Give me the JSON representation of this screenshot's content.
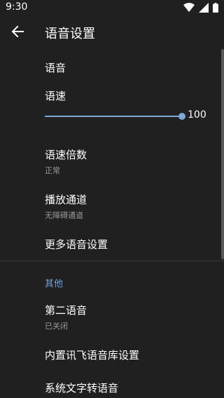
{
  "status_bar": {
    "time": "9:30",
    "icons": [
      "wifi-icon",
      "signal-icon",
      "battery-icon"
    ]
  },
  "app_bar": {
    "title": "语音设置",
    "back_icon": "arrow-left-icon"
  },
  "settings": {
    "voice_label": "语音",
    "speed_label": "语速",
    "speed_slider": {
      "value": 100,
      "max": 100,
      "accent": "#7fa7d6"
    },
    "speed_value_text": "100",
    "speed_multiplier_label": "语速倍数",
    "speed_multiplier_value": "正常",
    "playback_channel_label": "播放通道",
    "playback_channel_value": "无障碍通道",
    "more_settings_label": "更多语音设置"
  },
  "other": {
    "section_title": "其他",
    "second_voice_label": "第二语音",
    "second_voice_value": "已关闭",
    "builtin_voice_label": "内置讯飞语音库设置",
    "system_tts_label": "系统文字转语音"
  },
  "colors": {
    "background": "#202020",
    "accent": "#6ea1e6",
    "secondary_text": "#9a9a9a"
  }
}
